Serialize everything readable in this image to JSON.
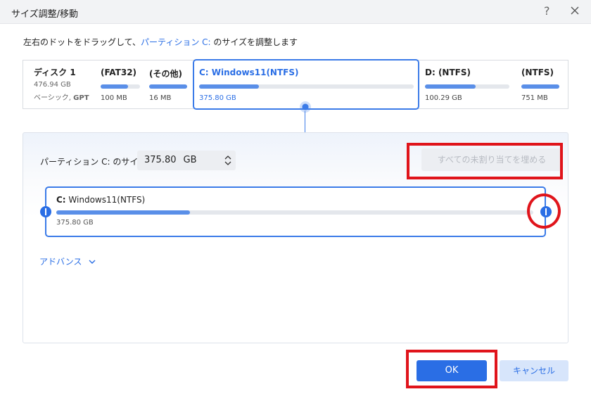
{
  "window": {
    "title": "サイズ調整/移動",
    "help_icon": "?"
  },
  "instruction": {
    "prefix": "左右のドットをドラッグして、",
    "highlight": "パーティション C:",
    "suffix": " のサイズを調整します"
  },
  "disk": {
    "name": "ディスク 1",
    "size": "476.94 GB",
    "type_prefix": "ベーシック, ",
    "type_bold": "GPT",
    "partitions": [
      {
        "label": "(FAT32)",
        "size": "100 MB",
        "fill": 0.7
      },
      {
        "label": "(その他)",
        "size": "16 MB",
        "fill": 1.0
      },
      {
        "label": "C: Windows11(NTFS)",
        "size": "375.80 GB",
        "fill": 0.28,
        "selected": true
      },
      {
        "label": "D: (NTFS)",
        "size": "100.29 GB",
        "fill": 0.6
      },
      {
        "label": "(NTFS)",
        "size": "751 MB",
        "fill": 1.0
      }
    ]
  },
  "detail": {
    "size_label": "パーティション C: のサイズ",
    "size_value": "375.80",
    "size_unit": "GB",
    "fill_button": "すべての未割り当てを埋める",
    "editor_drive": "C:",
    "editor_name": " Windows11(NTFS)",
    "editor_size": "375.80 GB",
    "editor_fill": 0.28,
    "advanced": "アドバンス"
  },
  "buttons": {
    "ok": "OK",
    "cancel": "キャンセル"
  },
  "colors": {
    "accent": "#2a6ee5",
    "highlight_box": "#e0141b",
    "bar_fill": "#5a8fe8"
  }
}
